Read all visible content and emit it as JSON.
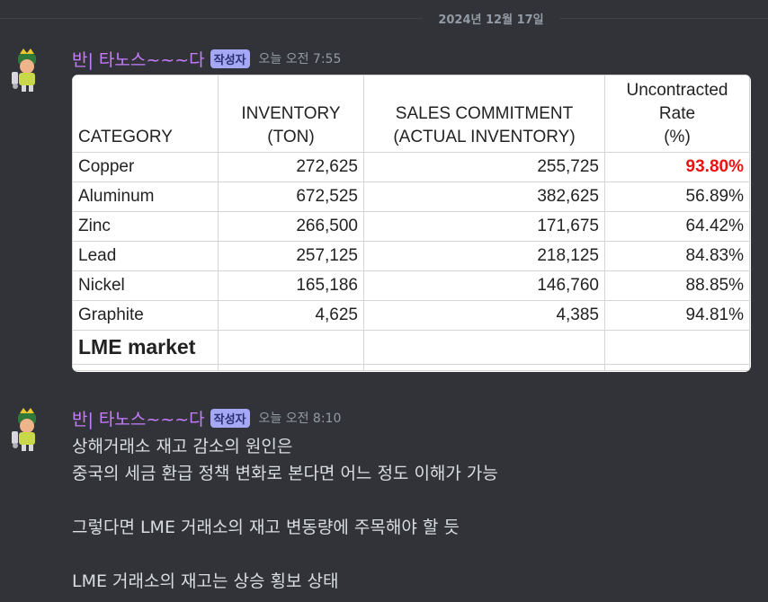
{
  "date_divider": "2024년 12월 17일",
  "messages": [
    {
      "username": "반| 타노스~~~다",
      "badge": "작성자",
      "timestamp": "오늘 오전 7:55"
    },
    {
      "username": "반| 타노스~~~다",
      "badge": "작성자",
      "timestamp": "오늘 오전 8:10",
      "lines": [
        "상해거래소 재고 감소의 원인은",
        "중국의 세금 환급 정책 변화로 본다면  어느 정도 이해가 가능",
        "",
        "그렇다면  LME 거래소의 재고 변동량에 주목해야 할 듯",
        "",
        "LME 거래소의 재고는 상승 횡보 상태"
      ]
    }
  ],
  "table": {
    "headers": {
      "category": "CATEGORY",
      "inventory": [
        "INVENTORY",
        "(TON)"
      ],
      "sales": [
        "SALES COMMITMENT",
        "(ACTUAL INVENTORY)"
      ],
      "rate": [
        "Uncontracted",
        "Rate",
        "(%)"
      ]
    },
    "rows": [
      {
        "category": "Copper",
        "inventory": "272,625",
        "sales": "255,725",
        "rate": "93.80%"
      },
      {
        "category": "Aluminum",
        "inventory": "672,525",
        "sales": "382,625",
        "rate": "56.89%"
      },
      {
        "category": "Zinc",
        "inventory": "266,500",
        "sales": "171,675",
        "rate": "64.42%"
      },
      {
        "category": "Lead",
        "inventory": "257,125",
        "sales": "218,125",
        "rate": "84.83%"
      },
      {
        "category": "Nickel",
        "inventory": "165,186",
        "sales": "146,760",
        "rate": "88.85%"
      },
      {
        "category": "Graphite",
        "inventory": "4,625",
        "sales": "4,385",
        "rate": "94.81%"
      }
    ],
    "footer_label": "LME market",
    "highlight_color": "#ee1111"
  },
  "colors": {
    "background": "#313338",
    "username": "#c77dff",
    "badge_bg": "#a4a8f5"
  }
}
